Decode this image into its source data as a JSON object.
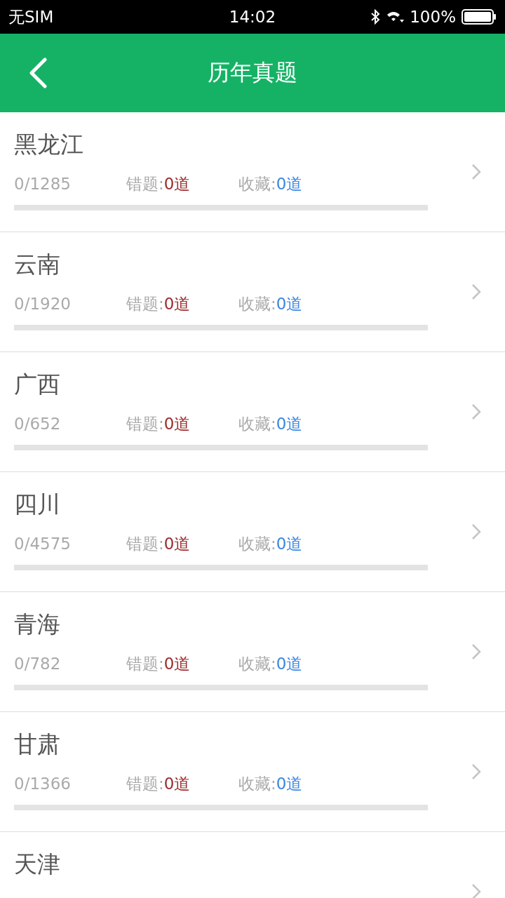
{
  "status_bar": {
    "carrier": "无SIM",
    "time": "14:02",
    "battery": "100%"
  },
  "header": {
    "title": "历年真题"
  },
  "items": [
    {
      "name": "黑龙江",
      "progress": "0/1285",
      "wrong_label": "错题:",
      "wrong_count": "0道",
      "fav_label": "收藏:",
      "fav_count": "0道",
      "level": 0
    },
    {
      "name": "云南",
      "progress": "0/1920",
      "wrong_label": "错题:",
      "wrong_count": "0道",
      "fav_label": "收藏:",
      "fav_count": "0道",
      "level": 0
    },
    {
      "name": "广西",
      "progress": "0/652",
      "wrong_label": "错题:",
      "wrong_count": "0道",
      "fav_label": "收藏:",
      "fav_count": "0道",
      "level": 0
    },
    {
      "name": "四川",
      "progress": "0/4575",
      "wrong_label": "错题:",
      "wrong_count": "0道",
      "fav_label": "收藏:",
      "fav_count": "0道",
      "level": 0
    },
    {
      "name": "青海",
      "progress": "0/782",
      "wrong_label": "错题:",
      "wrong_count": "0道",
      "fav_label": "收藏:",
      "fav_count": "0道",
      "level": 0
    },
    {
      "name": "甘肃",
      "progress": "0/1366",
      "wrong_label": "错题:",
      "wrong_count": "0道",
      "fav_label": "收藏:",
      "fav_count": "0道",
      "level": 0
    },
    {
      "name": "天津"
    }
  ]
}
